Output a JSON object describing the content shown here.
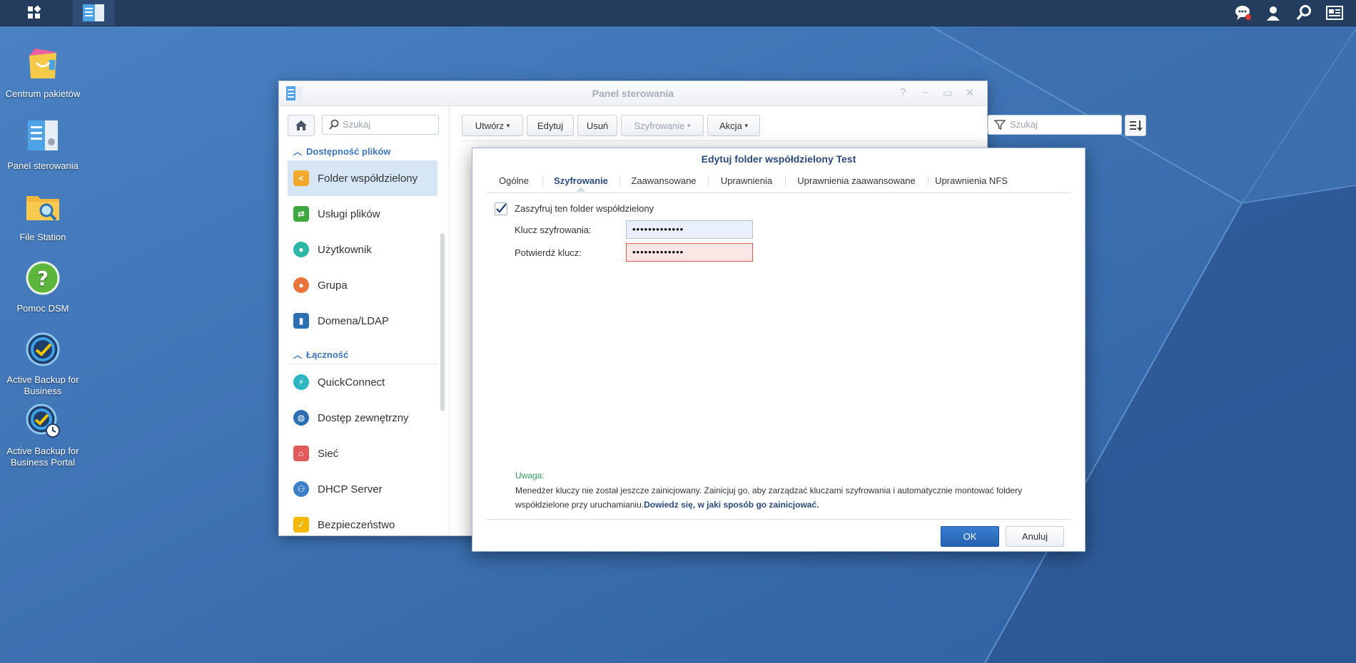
{
  "desktop": {
    "icons": [
      {
        "label": "Centrum pakietów"
      },
      {
        "label": "Panel sterowania"
      },
      {
        "label": "File Station"
      },
      {
        "label": "Pomoc DSM"
      },
      {
        "label": "Active Backup for Business"
      },
      {
        "label": "Active Backup for Business Portal"
      }
    ]
  },
  "control_panel": {
    "title": "Panel sterowania",
    "sidebar": {
      "search_placeholder": "Szukaj",
      "sections": [
        {
          "label": "Dostępność plików",
          "items": [
            "Folder współdzielony",
            "Usługi plików",
            "Użytkownik",
            "Grupa",
            "Domena/LDAP"
          ]
        },
        {
          "label": "Łączność",
          "items": [
            "QuickConnect",
            "Dostęp zewnętrzny",
            "Sieć",
            "DHCP Server",
            "Bezpieczeństwo"
          ]
        }
      ]
    },
    "toolbar": {
      "create": "Utwórz",
      "edit": "Edytuj",
      "delete": "Usuń",
      "encryption": "Szyfrowanie",
      "action": "Akcja",
      "search_placeholder": "Szukaj"
    }
  },
  "dialog": {
    "title": "Edytuj folder współdzielony Test",
    "tabs": [
      "Ogólne",
      "Szyfrowanie",
      "Zaawansowane",
      "Uprawnienia",
      "Uprawnienia zaawansowane",
      "Uprawnienia NFS"
    ],
    "active_tab": "Szyfrowanie",
    "encrypt_checkbox_label": "Zaszyfruj ten folder współdzielony",
    "encrypt_checked": true,
    "key_label": "Klucz szyfrowania:",
    "key_value": "•••••••••••••",
    "confirm_label": "Potwierdź klucz:",
    "confirm_value": "•••••••••••••",
    "note_title": "Uwaga:",
    "note_text": "Menedżer kluczy nie został jeszcze zainicjowany. Zainicjuj go, aby zarządzać kluczami szyfrowania i automatycznie montować foldery współdzielone przy uruchamianiu.",
    "note_link": "Dowiedz się, w jaki sposób go zainicjować.",
    "ok_label": "OK",
    "cancel_label": "Anuluj"
  }
}
